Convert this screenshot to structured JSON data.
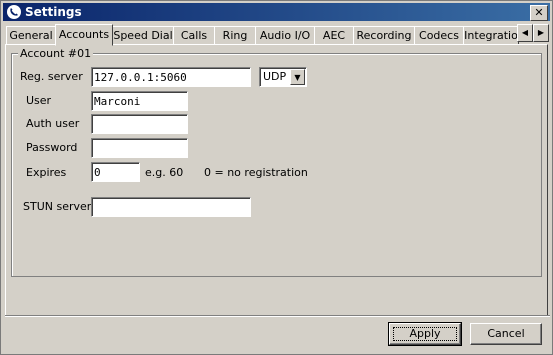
{
  "window": {
    "title": "Settings",
    "close_label": "✕"
  },
  "tabs": [
    {
      "label": "General"
    },
    {
      "label": "Accounts",
      "active": true
    },
    {
      "label": "Speed Dial"
    },
    {
      "label": "Calls"
    },
    {
      "label": "Ring"
    },
    {
      "label": "Audio I/O"
    },
    {
      "label": "AEC"
    },
    {
      "label": "Recording"
    },
    {
      "label": "Codecs"
    },
    {
      "label": "Integratio"
    }
  ],
  "tab_scroll": {
    "left": "◀",
    "right": "▶"
  },
  "account": {
    "group_title": "Account #01",
    "reg_server_label": "Reg. server",
    "reg_server_value": "127.0.0.1:5060",
    "transport_value": "UDP",
    "user_label": "User",
    "user_value": "Marconi",
    "auth_user_label": "Auth user",
    "auth_user_value": "",
    "password_label": "Password",
    "password_value": "",
    "expires_label": "Expires",
    "expires_value": "0",
    "expires_hint": "e.g. 60",
    "expires_note": "0 = no registration",
    "stun_label": "STUN server",
    "stun_value": ""
  },
  "buttons": {
    "apply": "Apply",
    "cancel": "Cancel"
  },
  "icons": {
    "app": "phone-icon",
    "dropdown": "chevron-down-icon"
  }
}
